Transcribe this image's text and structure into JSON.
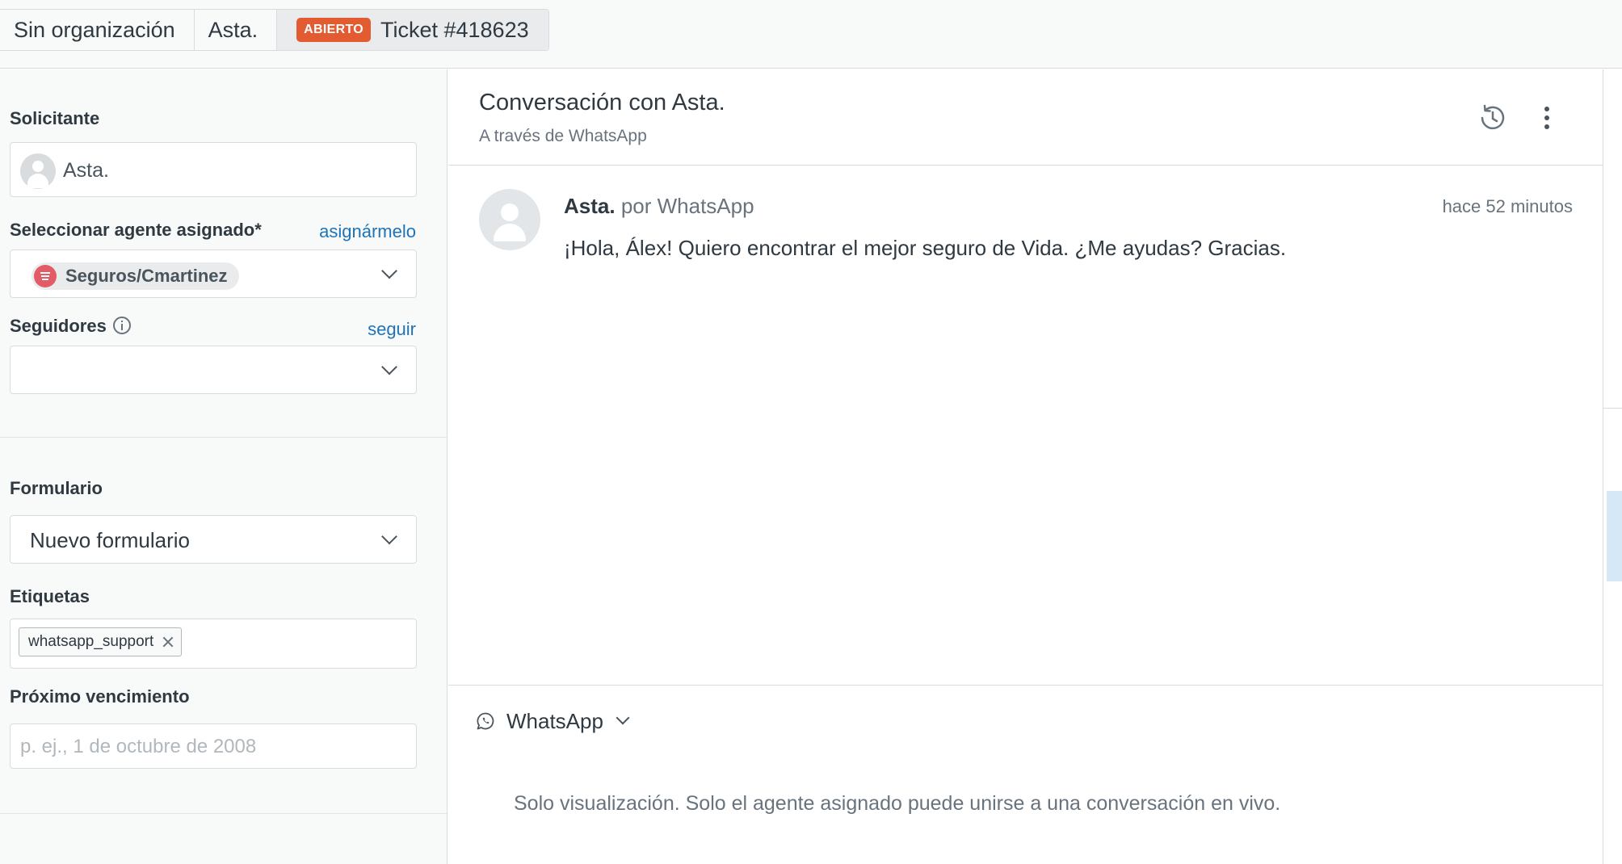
{
  "breadcrumbs": {
    "organization": "Sin organización",
    "requester": "Asta.",
    "status_badge": "ABIERTO",
    "ticket": "Ticket #418623"
  },
  "sidebar": {
    "requester": {
      "label": "Solicitante",
      "value": "Asta."
    },
    "assignee": {
      "label": "Seleccionar agente asignado*",
      "link": "asignármelo",
      "value": "Seguros/Cmartinez"
    },
    "followers": {
      "label": "Seguidores",
      "link": "seguir",
      "value": ""
    },
    "form": {
      "label": "Formulario",
      "value": "Nuevo formulario"
    },
    "tags": {
      "label": "Etiquetas",
      "items": [
        "whatsapp_support"
      ]
    },
    "due_date": {
      "label": "Próximo vencimiento",
      "placeholder": "p. ej., 1 de octubre de 2008"
    }
  },
  "conversation": {
    "title": "Conversación con Asta.",
    "subtitle": "A través de WhatsApp",
    "header_icons": [
      "history-icon",
      "more-vertical-icon"
    ],
    "message": {
      "author": "Asta.",
      "channel": "por WhatsApp",
      "time": "hace 52 minutos",
      "text": "¡Hola, Álex! Quiero encontrar el mejor seguro de Vida. ¿Me ayudas? Gracias."
    },
    "composer": {
      "channel": "WhatsApp",
      "note": "Solo visualización. Solo el agente asignado puede unirse a una conversación en vivo."
    }
  },
  "colors": {
    "accent_link": "#1f73b7",
    "status_open": "#e35b30",
    "agent_icon": "#e35b66",
    "sidebar_bg": "#f8f9f9",
    "border": "#d8dcde"
  }
}
